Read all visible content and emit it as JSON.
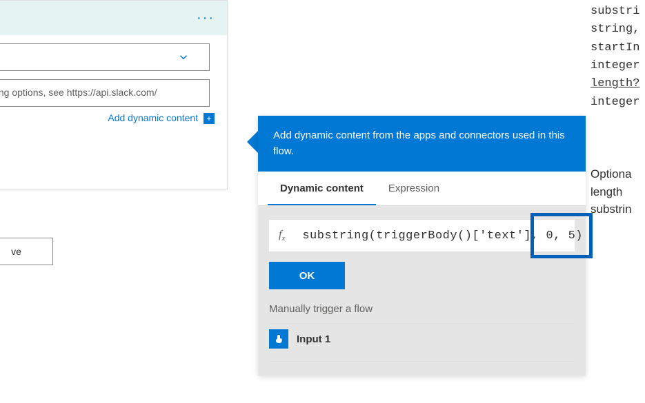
{
  "card": {
    "placeholder_options": "tting options, see https://api.slack.com/",
    "add_dynamic_content": "Add dynamic content"
  },
  "save_button": "ve",
  "panel": {
    "header": "Add dynamic content from the apps and connectors used in this flow.",
    "tabs": {
      "dynamic": "Dynamic content",
      "expression": "Expression"
    },
    "fx_label": "fx",
    "expression": "substring(triggerBody()['text'], 0, 5)",
    "ok": "OK",
    "trigger_section": "Manually trigger a flow",
    "input1": "Input 1"
  },
  "sidebar": {
    "line1": "substri",
    "line2": "string,",
    "line3": "startIn",
    "line4": "integer",
    "line5": "length?",
    "line6": "integer",
    "desc1": "Optiona",
    "desc2": "length",
    "desc3": "substrin"
  }
}
